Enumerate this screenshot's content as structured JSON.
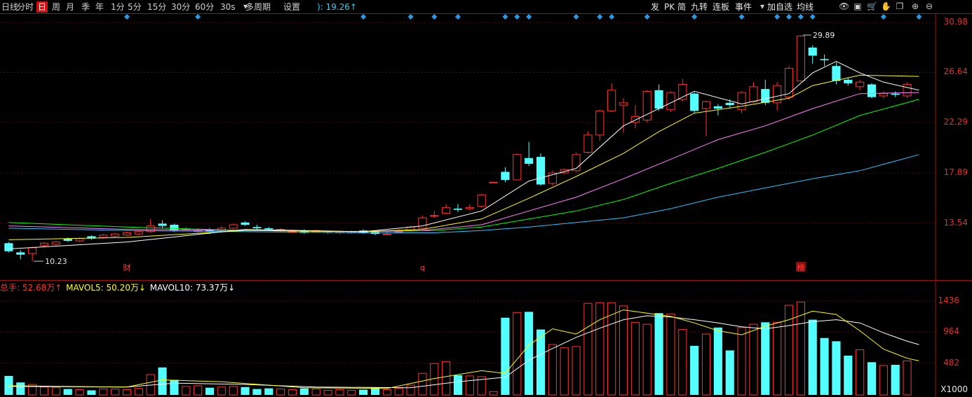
{
  "toolbar": {
    "left_items": [
      "日线",
      "分时",
      "日",
      "周",
      "月",
      "季",
      "年",
      "1分",
      "5分",
      "15分",
      "30分",
      "60分",
      "30s",
      "多周期",
      "设置"
    ],
    "active_item": "日",
    "readout": "): 19.26↑",
    "right_items": [
      "发",
      "PK",
      "简",
      "九转",
      "连板",
      "事件",
      "加自选",
      "均线"
    ],
    "icons": [
      "dropdown-icon",
      "eye-icon",
      "save-icon",
      "cart-icon",
      "hand-icon",
      "copy-icon",
      "zoom-in-icon",
      "zoom-out-icon"
    ]
  },
  "price_axis": {
    "ticks": [
      "30.98",
      "26.64",
      "22.29",
      "17.89",
      "13.54"
    ],
    "tick_values": [
      30.98,
      26.64,
      22.29,
      17.89,
      13.54
    ],
    "range": [
      9.2,
      31.6
    ]
  },
  "volume_axis": {
    "ticks": [
      "1436",
      "964",
      "482"
    ],
    "tick_values": [
      1436,
      964,
      482
    ],
    "unit": "X1000",
    "range": [
      0,
      1520
    ]
  },
  "annotations": {
    "high": "29.89",
    "low": "10.23",
    "markers": [
      "财",
      "q",
      "榜"
    ]
  },
  "volume_legend": {
    "total_label": "总手: 52.68万↑",
    "mavol5_label": "MAVOL5: 50.20万↓",
    "mavol10_label": "MAVOL10: 73.37万↓"
  },
  "colors": {
    "up": "#ff3232",
    "down": "#54ffff",
    "ma5": "#ffffff",
    "ma10": "#ffff00",
    "ma20": "#ff80ff",
    "ma30": "#00ff00",
    "ma60": "#2bc3ff"
  },
  "chart_data": {
    "type": "candlestick",
    "candles": [
      [
        11.8,
        11.1,
        11.9,
        11.0,
        290
      ],
      [
        11.0,
        10.8,
        11.2,
        10.4,
        190
      ],
      [
        10.9,
        11.4,
        11.5,
        10.23,
        160
      ],
      [
        11.6,
        11.8,
        11.9,
        11.4,
        120
      ],
      [
        11.7,
        11.9,
        12.0,
        11.6,
        110
      ],
      [
        12.2,
        12.0,
        12.3,
        11.9,
        90
      ],
      [
        12.0,
        12.2,
        12.3,
        11.9,
        80
      ],
      [
        12.4,
        12.2,
        12.5,
        12.1,
        70
      ],
      [
        12.3,
        12.5,
        12.6,
        12.2,
        90
      ],
      [
        12.4,
        12.6,
        12.7,
        12.3,
        90
      ],
      [
        12.5,
        12.7,
        12.8,
        12.4,
        80
      ],
      [
        12.6,
        12.8,
        12.9,
        12.5,
        100
      ],
      [
        12.8,
        13.3,
        13.9,
        12.7,
        310
      ],
      [
        13.5,
        13.3,
        13.8,
        13.1,
        420
      ],
      [
        13.4,
        12.9,
        13.5,
        12.8,
        230
      ],
      [
        13.0,
        13.0,
        13.2,
        12.9,
        130
      ],
      [
        12.8,
        12.9,
        13.1,
        12.7,
        140
      ],
      [
        13.0,
        12.8,
        13.1,
        12.6,
        110
      ],
      [
        12.9,
        13.1,
        13.3,
        12.8,
        120
      ],
      [
        13.1,
        13.4,
        13.5,
        13.0,
        130
      ],
      [
        13.6,
        13.4,
        13.7,
        13.3,
        120
      ],
      [
        13.2,
        13.1,
        13.4,
        13.0,
        90
      ],
      [
        13.1,
        13.0,
        13.2,
        12.9,
        100
      ],
      [
        13.0,
        13.0,
        13.1,
        12.8,
        90
      ],
      [
        12.8,
        12.8,
        13.0,
        12.7,
        80
      ],
      [
        12.9,
        12.7,
        13.0,
        12.6,
        100
      ],
      [
        12.8,
        12.9,
        13.0,
        12.7,
        90
      ],
      [
        12.8,
        12.8,
        12.9,
        12.6,
        70
      ],
      [
        12.7,
        12.8,
        12.9,
        12.6,
        80
      ],
      [
        12.7,
        12.8,
        12.9,
        12.6,
        70
      ],
      [
        12.9,
        12.7,
        13.0,
        12.6,
        80
      ],
      [
        12.8,
        12.6,
        12.9,
        12.5,
        110
      ],
      [
        12.6,
        12.6,
        12.8,
        12.5,
        80
      ],
      [
        12.8,
        12.8,
        13.0,
        12.7,
        100
      ],
      [
        12.9,
        13.2,
        13.3,
        12.8,
        150
      ],
      [
        13.1,
        14.0,
        14.2,
        13.0,
        330
      ],
      [
        14.2,
        14.2,
        14.6,
        14.0,
        480
      ],
      [
        14.4,
        14.9,
        15.2,
        14.3,
        510
      ],
      [
        14.8,
        14.7,
        15.2,
        14.5,
        300
      ],
      [
        14.8,
        14.9,
        15.2,
        14.6,
        290
      ],
      [
        15.0,
        16.0,
        16.1,
        14.9,
        280
      ],
      [
        17.1,
        17.1,
        17.1,
        17.1,
        50
      ],
      [
        18.0,
        17.3,
        18.4,
        17.1,
        1180
      ],
      [
        17.3,
        19.5,
        19.6,
        17.3,
        1260
      ],
      [
        19.2,
        18.7,
        20.6,
        18.5,
        1270
      ],
      [
        19.3,
        16.9,
        19.6,
        16.8,
        1000
      ],
      [
        17.0,
        17.9,
        18.1,
        16.8,
        770
      ],
      [
        17.9,
        18.2,
        18.3,
        17.8,
        720
      ],
      [
        18.1,
        19.5,
        19.7,
        18.0,
        740
      ],
      [
        19.7,
        21.2,
        21.5,
        19.6,
        1400
      ],
      [
        21.2,
        23.3,
        23.4,
        20.7,
        1410
      ],
      [
        23.3,
        25.1,
        25.7,
        23.2,
        1410
      ],
      [
        23.8,
        24.0,
        24.4,
        21.4,
        1360
      ],
      [
        22.3,
        22.8,
        23.8,
        21.8,
        1110
      ],
      [
        22.5,
        25.0,
        25.1,
        22.3,
        1080
      ],
      [
        25.1,
        23.5,
        25.6,
        23.3,
        1250
      ],
      [
        23.4,
        24.9,
        25.0,
        23.2,
        1240
      ],
      [
        24.3,
        25.6,
        26.1,
        24.1,
        1000
      ],
      [
        24.8,
        23.3,
        24.9,
        23.1,
        750
      ],
      [
        23.5,
        24.1,
        24.2,
        21.1,
        930
      ],
      [
        23.7,
        23.5,
        23.9,
        22.9,
        1030
      ],
      [
        24.0,
        23.8,
        24.3,
        23.6,
        680
      ],
      [
        23.4,
        24.9,
        25.0,
        23.1,
        1030
      ],
      [
        24.1,
        25.4,
        25.8,
        24.0,
        1080
      ],
      [
        25.2,
        24.0,
        26.0,
        23.8,
        1110
      ],
      [
        24.0,
        25.5,
        25.8,
        23.3,
        1110
      ],
      [
        24.5,
        27.0,
        27.2,
        24.3,
        1370
      ],
      [
        25.9,
        29.8,
        29.89,
        25.8,
        1420
      ],
      [
        28.8,
        28.1,
        29.0,
        27.4,
        1150
      ],
      [
        27.8,
        27.7,
        28.2,
        27.2,
        870
      ],
      [
        27.2,
        25.9,
        27.5,
        25.6,
        820
      ],
      [
        26.0,
        25.7,
        26.2,
        25.5,
        600
      ],
      [
        25.4,
        25.8,
        26.0,
        25.1,
        690
      ],
      [
        25.6,
        24.5,
        25.7,
        24.4,
        500
      ],
      [
        24.6,
        24.8,
        25.0,
        24.4,
        450
      ],
      [
        24.8,
        24.7,
        25.0,
        24.5,
        460
      ],
      [
        24.6,
        25.6,
        25.8,
        24.4,
        520
      ]
    ],
    "ma_price": {
      "ma5": [
        [
          0,
          11.3
        ],
        [
          10,
          11.9
        ],
        [
          20,
          13.0
        ],
        [
          30,
          12.8
        ],
        [
          35,
          13.3
        ],
        [
          40,
          14.6
        ],
        [
          44,
          17.2
        ],
        [
          48,
          18.3
        ],
        [
          52,
          22.0
        ],
        [
          55,
          23.5
        ],
        [
          58,
          25.0
        ],
        [
          62,
          23.9
        ],
        [
          66,
          24.8
        ],
        [
          68,
          26.6
        ],
        [
          70,
          27.6
        ],
        [
          72,
          26.6
        ],
        [
          74,
          25.8
        ],
        [
          77,
          25.1
        ]
      ],
      "ma10": [
        [
          0,
          12.1
        ],
        [
          10,
          12.3
        ],
        [
          20,
          12.9
        ],
        [
          30,
          12.8
        ],
        [
          35,
          13.0
        ],
        [
          40,
          13.9
        ],
        [
          44,
          15.7
        ],
        [
          48,
          17.6
        ],
        [
          52,
          19.6
        ],
        [
          55,
          21.5
        ],
        [
          58,
          23.1
        ],
        [
          62,
          23.7
        ],
        [
          66,
          24.4
        ],
        [
          68,
          25.5
        ],
        [
          72,
          26.4
        ],
        [
          77,
          26.3
        ]
      ],
      "ma20": [
        [
          0,
          13.3
        ],
        [
          10,
          13.0
        ],
        [
          20,
          12.9
        ],
        [
          30,
          12.8
        ],
        [
          35,
          12.9
        ],
        [
          40,
          13.4
        ],
        [
          44,
          14.6
        ],
        [
          48,
          15.8
        ],
        [
          52,
          17.4
        ],
        [
          56,
          19.1
        ],
        [
          60,
          20.8
        ],
        [
          64,
          22.0
        ],
        [
          68,
          23.5
        ],
        [
          72,
          24.8
        ],
        [
          77,
          24.9
        ]
      ],
      "ma30": [
        [
          0,
          13.6
        ],
        [
          10,
          13.2
        ],
        [
          20,
          12.9
        ],
        [
          30,
          12.8
        ],
        [
          36,
          12.9
        ],
        [
          40,
          13.2
        ],
        [
          44,
          13.9
        ],
        [
          48,
          14.6
        ],
        [
          52,
          15.6
        ],
        [
          56,
          17.0
        ],
        [
          60,
          18.3
        ],
        [
          64,
          19.7
        ],
        [
          68,
          21.2
        ],
        [
          72,
          22.9
        ],
        [
          77,
          24.3
        ]
      ],
      "ma60": [
        [
          0,
          13.1
        ],
        [
          10,
          12.9
        ],
        [
          20,
          12.8
        ],
        [
          30,
          12.7
        ],
        [
          36,
          12.7
        ],
        [
          40,
          12.9
        ],
        [
          44,
          13.2
        ],
        [
          48,
          13.6
        ],
        [
          52,
          14.0
        ],
        [
          56,
          14.8
        ],
        [
          60,
          15.8
        ],
        [
          64,
          16.6
        ],
        [
          68,
          17.4
        ],
        [
          72,
          18.1
        ],
        [
          77,
          19.5
        ]
      ]
    },
    "ma_volume": {
      "mavol5": [
        [
          0,
          140
        ],
        [
          10,
          120
        ],
        [
          13,
          230
        ],
        [
          18,
          200
        ],
        [
          25,
          110
        ],
        [
          32,
          100
        ],
        [
          36,
          250
        ],
        [
          40,
          370
        ],
        [
          42,
          330
        ],
        [
          44,
          760
        ],
        [
          46,
          1010
        ],
        [
          48,
          930
        ],
        [
          50,
          1150
        ],
        [
          52,
          1300
        ],
        [
          54,
          1250
        ],
        [
          56,
          1200
        ],
        [
          58,
          1100
        ],
        [
          60,
          980
        ],
        [
          62,
          920
        ],
        [
          64,
          1050
        ],
        [
          66,
          1150
        ],
        [
          68,
          1280
        ],
        [
          70,
          1230
        ],
        [
          72,
          980
        ],
        [
          74,
          700
        ],
        [
          76,
          560
        ],
        [
          77,
          520
        ]
      ],
      "mavol10": [
        [
          0,
          130
        ],
        [
          10,
          120
        ],
        [
          14,
          180
        ],
        [
          20,
          160
        ],
        [
          26,
          120
        ],
        [
          34,
          110
        ],
        [
          38,
          200
        ],
        [
          42,
          270
        ],
        [
          44,
          530
        ],
        [
          46,
          710
        ],
        [
          48,
          880
        ],
        [
          50,
          1020
        ],
        [
          52,
          1150
        ],
        [
          54,
          1210
        ],
        [
          56,
          1190
        ],
        [
          58,
          1150
        ],
        [
          60,
          1100
        ],
        [
          62,
          1040
        ],
        [
          64,
          1010
        ],
        [
          66,
          1060
        ],
        [
          68,
          1120
        ],
        [
          70,
          1150
        ],
        [
          72,
          1100
        ],
        [
          74,
          950
        ],
        [
          76,
          820
        ],
        [
          77,
          770
        ]
      ]
    }
  }
}
